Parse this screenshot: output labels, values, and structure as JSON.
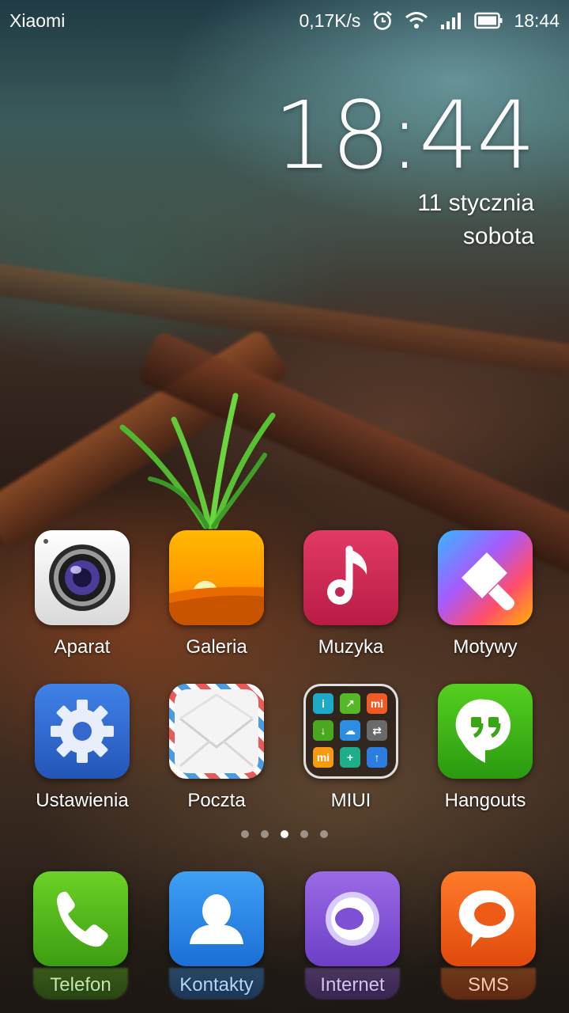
{
  "status_bar": {
    "carrier": "Xiaomi",
    "network_speed": "0,17K/s",
    "time": "18:44",
    "icons": [
      "alarm-icon",
      "wifi-icon",
      "signal-icon",
      "battery-icon"
    ]
  },
  "clock_widget": {
    "time": "18:44",
    "date": "11 stycznia",
    "day": "sobota"
  },
  "apps": [
    {
      "label": "Aparat",
      "icon": "camera-icon"
    },
    {
      "label": "Galeria",
      "icon": "gallery-icon"
    },
    {
      "label": "Muzyka",
      "icon": "music-icon"
    },
    {
      "label": "Motywy",
      "icon": "themes-icon"
    },
    {
      "label": "Ustawienia",
      "icon": "settings-icon"
    },
    {
      "label": "Poczta",
      "icon": "mail-icon"
    },
    {
      "label": "MIUI",
      "icon": "folder-icon"
    },
    {
      "label": "Hangouts",
      "icon": "hangouts-icon"
    }
  ],
  "folder_mini": [
    "i",
    "↗",
    "mi",
    "↓",
    "☁",
    "⇄",
    "mi",
    "+",
    "↑"
  ],
  "page_indicator": {
    "count": 5,
    "active": 3
  },
  "dock": [
    {
      "label": "Telefon",
      "icon": "phone-icon"
    },
    {
      "label": "Kontakty",
      "icon": "contacts-icon"
    },
    {
      "label": "Internet",
      "icon": "browser-icon"
    },
    {
      "label": "SMS",
      "icon": "sms-icon"
    }
  ]
}
